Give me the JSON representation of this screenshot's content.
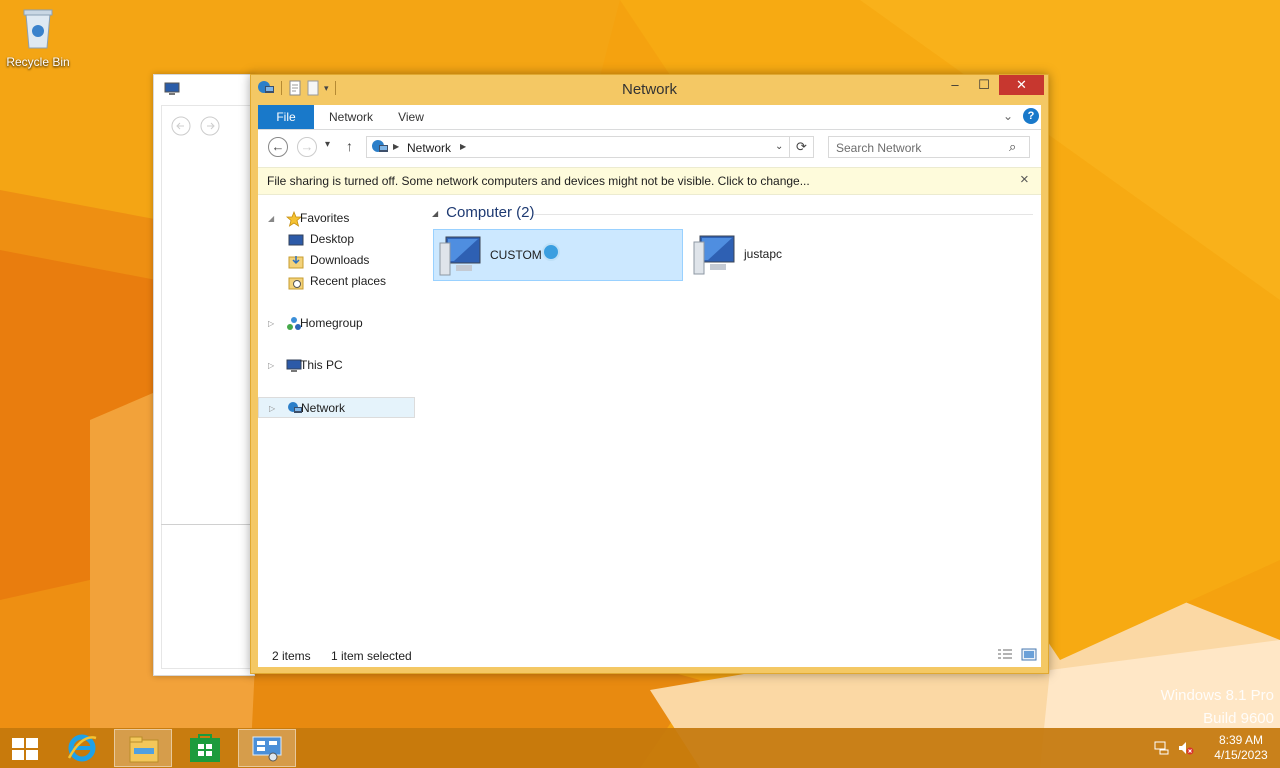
{
  "desktop": {
    "icons": [
      {
        "label": "Recycle Bin",
        "icon": "recycle-bin-icon"
      }
    ],
    "watermark": {
      "line1": "Windows 8.1 Pro",
      "line2": "Build 9600"
    }
  },
  "window": {
    "title": "Network",
    "controls": {
      "minimize": "–",
      "maximize": "☐",
      "close": "✕"
    }
  },
  "ribbon": {
    "tabs": [
      "File",
      "Network",
      "View"
    ],
    "help": "?"
  },
  "address": {
    "location": "Network",
    "search_placeholder": "Search Network"
  },
  "infobar": {
    "message": "File sharing is turned off. Some network computers and devices might not be visible. Click to change..."
  },
  "nav_pane": {
    "favorites": "Favorites",
    "favorites_children": [
      "Desktop",
      "Downloads",
      "Recent places"
    ],
    "homegroup": "Homegroup",
    "this_pc": "This PC",
    "network": "Network"
  },
  "content": {
    "group_title": "Computer (2)",
    "items": [
      {
        "name": "CUSTOM",
        "selected": true
      },
      {
        "name": "justapc",
        "selected": false
      }
    ]
  },
  "status": {
    "count": "2 items",
    "selection": "1 item selected"
  },
  "taskbar": {
    "pinned": [
      "start-icon",
      "internet-explorer-icon",
      "file-explorer-icon",
      "store-icon",
      "network-control-icon"
    ],
    "time": "8:39 AM",
    "date": "4/15/2023"
  },
  "colors": {
    "accent": "#1979ca",
    "window_frame": "#f4c864",
    "desktop": "#f39a10",
    "selection": "#cce8ff"
  }
}
